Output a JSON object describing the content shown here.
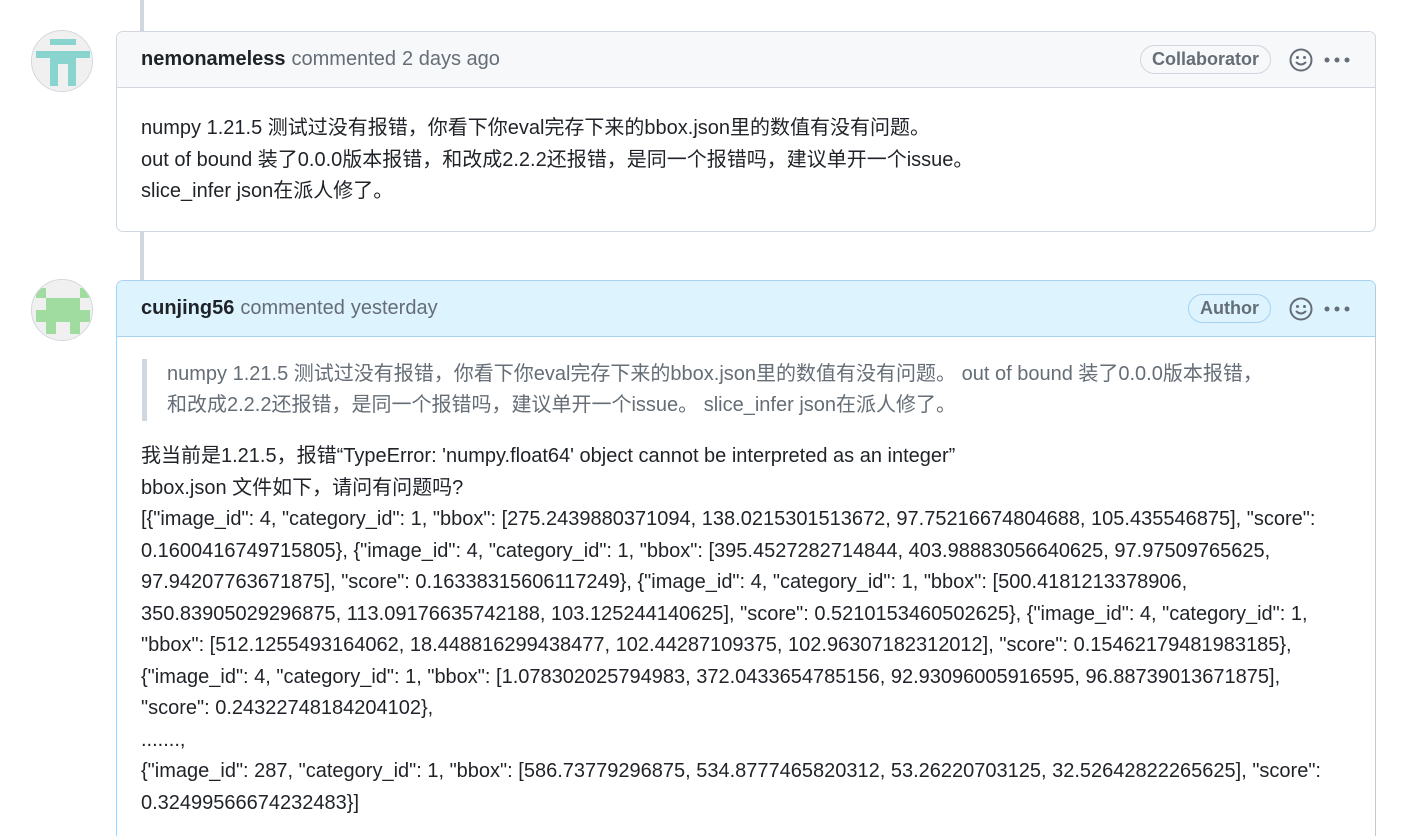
{
  "comments": [
    {
      "author": "nemonameless",
      "action": "commented",
      "time": "2 days ago",
      "badge": "Collaborator",
      "avatar_color": "#8ad4d0",
      "body": [
        "numpy 1.21.5 测试过没有报错，你看下你eval完存下来的bbox.json里的数值有没有问题。",
        "out of bound 装了0.0.0版本报错，和改成2.2.2还报错，是同一个报错吗，建议单开一个issue。",
        "slice_infer json在派人修了。"
      ]
    },
    {
      "author": "cunjing56",
      "action": "commented",
      "time": "yesterday",
      "badge": "Author",
      "avatar_color": "#a0dca0",
      "quote": [
        "numpy 1.21.5 测试过没有报错，你看下你eval完存下来的bbox.json里的数值有没有问题。 out of bound 装了0.0.0版本报错，",
        "和改成2.2.2还报错，是同一个报错吗，建议单开一个issue。 slice_infer json在派人修了。"
      ],
      "body": [
        "我当前是1.21.5，报错“TypeError: 'numpy.float64' object cannot be interpreted as an integer”",
        "bbox.json 文件如下，请问有问题吗?",
        "[{\"image_id\": 4, \"category_id\": 1, \"bbox\": [275.2439880371094, 138.0215301513672, 97.75216674804688, 105.435546875], \"score\":",
        "0.1600416749715805}, {\"image_id\": 4, \"category_id\": 1, \"bbox\": [395.4527282714844, 403.98883056640625, 97.97509765625,",
        "97.94207763671875], \"score\": 0.16338315606117249}, {\"image_id\": 4, \"category_id\": 1, \"bbox\": [500.4181213378906,",
        "350.83905029296875, 113.09176635742188, 103.125244140625], \"score\": 0.5210153460502625}, {\"image_id\": 4, \"category_id\": 1,",
        "\"bbox\": [512.1255493164062, 18.448816299438477, 102.44287109375, 102.96307182312012], \"score\": 0.15462179481983185},",
        "{\"image_id\": 4, \"category_id\": 1, \"bbox\": [1.078302025794983, 372.0433654785156, 92.93096005916595, 96.88739013671875],",
        "\"score\": 0.24322748184204102},",
        ".......,",
        "{\"image_id\": 287, \"category_id\": 1, \"bbox\": [586.73779296875, 534.8777465820312, 53.26220703125, 32.52642822265625], \"score\":",
        "0.32499566674232483}]"
      ]
    }
  ]
}
